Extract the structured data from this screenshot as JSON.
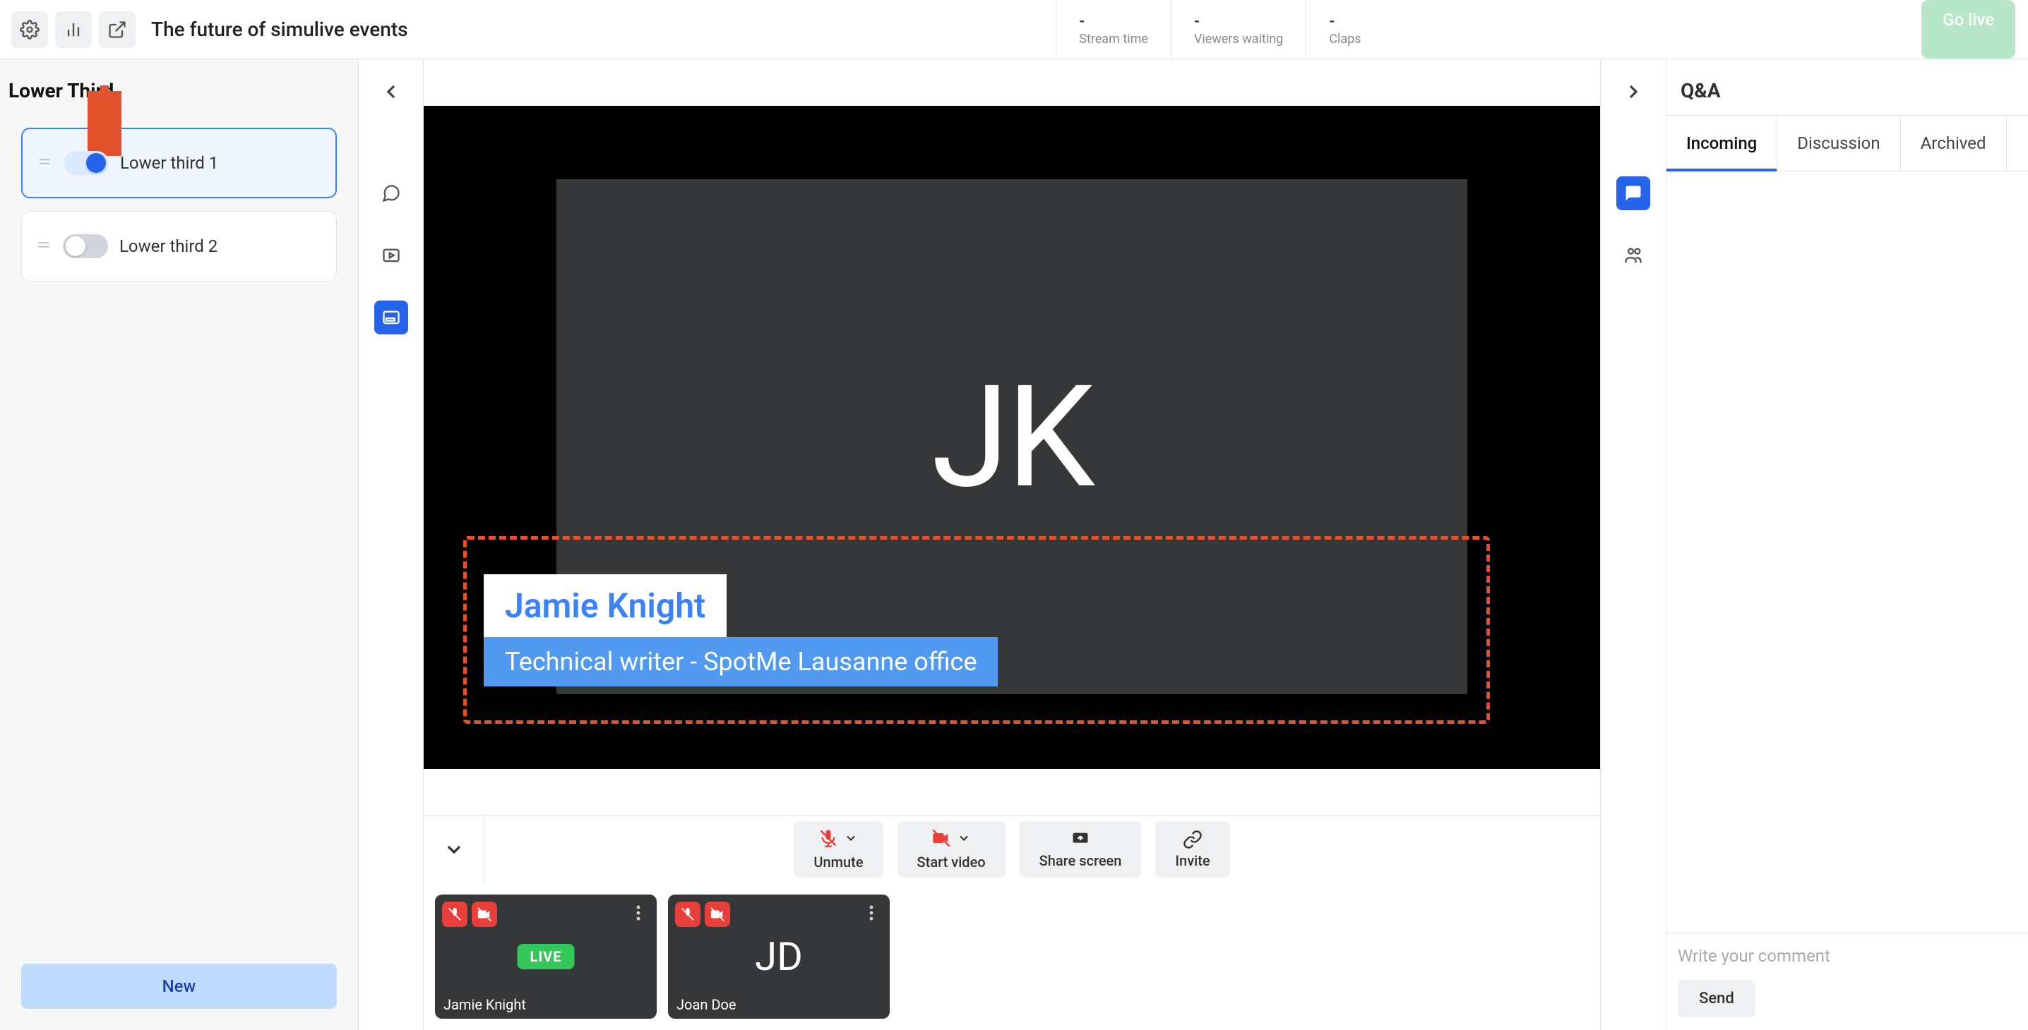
{
  "header": {
    "title": "The future of simulive events",
    "stats": {
      "stream_time": {
        "value": "-",
        "label": "Stream time"
      },
      "viewers": {
        "value": "-",
        "label": "Viewers waiting"
      },
      "claps": {
        "value": "-",
        "label": "Claps"
      }
    },
    "go_live": "Go live"
  },
  "left": {
    "title": "Lower Third",
    "items": [
      {
        "label": "Lower third 1",
        "active": true,
        "on": true
      },
      {
        "label": "Lower third 2",
        "active": false,
        "on": false
      }
    ],
    "new_button": "New"
  },
  "stage": {
    "speaker_initials": "JK",
    "lower_third": {
      "name": "Jamie Knight",
      "subtitle": "Technical writer - SpotMe Lausanne office"
    }
  },
  "controls": {
    "unmute": "Unmute",
    "start_video": "Start video",
    "share_screen": "Share screen",
    "invite": "Invite"
  },
  "thumbs": [
    {
      "name": "Jamie Knight",
      "initials": "",
      "live": true,
      "live_label": "LIVE"
    },
    {
      "name": "Joan Doe",
      "initials": "JD",
      "live": false
    }
  ],
  "qa": {
    "title": "Q&A",
    "tabs": {
      "incoming": "Incoming",
      "discussion": "Discussion",
      "archived": "Archived"
    },
    "placeholder": "Write your comment",
    "send": "Send"
  }
}
